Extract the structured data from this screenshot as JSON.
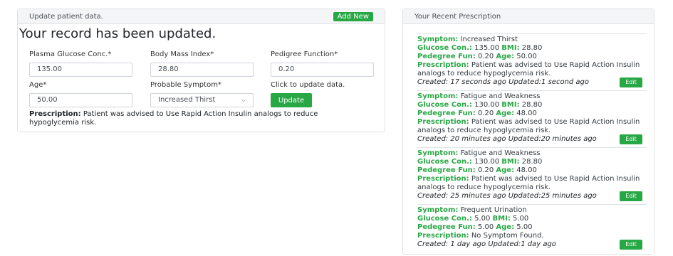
{
  "left_panel": {
    "header_title": "Update patient data.",
    "add_new_label": "Add New",
    "updated_message": "Your record has been updated.",
    "fields": {
      "glucose": {
        "label": "Plasma Glucose Conc.*",
        "value": "135.00"
      },
      "bmi": {
        "label": "Body Mass Index*",
        "value": "28.80"
      },
      "pedigree": {
        "label": "Pedigree Function*",
        "value": "0.20"
      },
      "age": {
        "label": "Age*",
        "value": "50.00"
      },
      "symptom": {
        "label": "Probable Symptom*",
        "value": "Increased Thirst"
      }
    },
    "update_hint": "Click to update data.",
    "update_label": "Update",
    "prescription_label": "Prescription:",
    "prescription_text": "Patient was advised to Use Rapid Action Insulin analogs to reduce hypoglycemia risk."
  },
  "right_panel": {
    "header_title": "Your Recent Prescription",
    "labels": {
      "symptom": "Symptom:",
      "glucose": "Glucose Con.:",
      "bmi": "BMI:",
      "pedigree": "Pedegree Fun:",
      "age": "Age:",
      "prescription": "Prescription:",
      "created": "Created:",
      "updated": "Updated:"
    },
    "edit_label": "Edit",
    "items": [
      {
        "symptom": "Increased Thirst",
        "glucose": "135.00",
        "bmi": "28.80",
        "pedigree": "0.20",
        "age": "50.00",
        "prescription": "Patient was advised to Use Rapid Action Insulin analogs to reduce hypoglycemia risk.",
        "created": "17 seconds ago",
        "updated": "1 second ago"
      },
      {
        "symptom": "Fatigue and Weakness",
        "glucose": "130.00",
        "bmi": "28.80",
        "pedigree": "0.20",
        "age": "48.00",
        "prescription": "Patient was advised to Use Rapid Action Insulin analogs to reduce hypoglycemia risk.",
        "created": "20 minutes ago",
        "updated": "20 minutes ago"
      },
      {
        "symptom": "Fatigue and Weakness",
        "glucose": "130.00",
        "bmi": "28.80",
        "pedigree": "0.20",
        "age": "48.00",
        "prescription": "Patient was advised to Use Rapid Action Insulin analogs to reduce hypoglycemia risk.",
        "created": "25 minutes ago",
        "updated": "25 minutes ago"
      },
      {
        "symptom": "Frequent Urination",
        "glucose": "5.00",
        "bmi": "5.00",
        "pedigree": "5.00",
        "age": "5.00",
        "prescription": "No Symptom Found.",
        "created": "1 day ago",
        "updated": "1 day ago"
      }
    ]
  }
}
